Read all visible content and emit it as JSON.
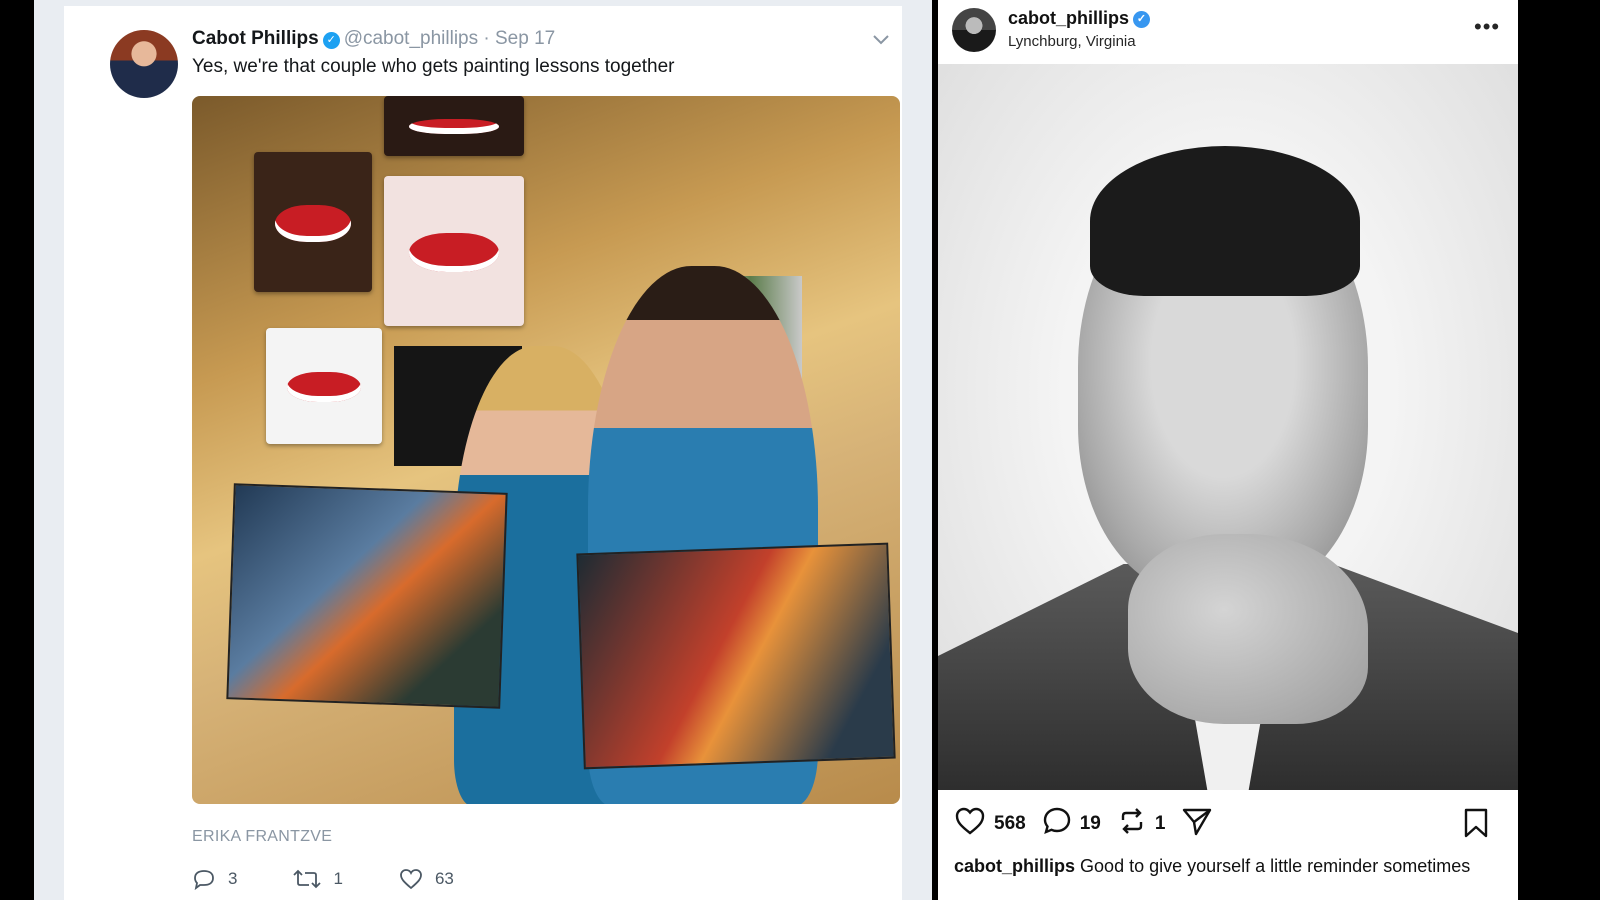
{
  "tweet": {
    "name": "Cabot Phillips",
    "verified_mark": "✓",
    "handle": "@cabot_phillips",
    "separator": "·",
    "date": "Sep 17",
    "text": "Yes, we're that couple who gets painting lessons together",
    "photo_credit": "ERIKA FRANTZVE",
    "actions": {
      "replies": "3",
      "retweets": "1",
      "likes": "63"
    },
    "icons": [
      "chevron-down-icon",
      "reply-icon",
      "retweet-icon",
      "heart-icon"
    ],
    "accent_color": "#1da1f2"
  },
  "instagram": {
    "username": "cabot_phillips",
    "verified_mark": "✓",
    "location": "Lynchburg, Virginia",
    "more": "•••",
    "actions": {
      "likes": "568",
      "comments": "19",
      "reposts": "1"
    },
    "caption_user": "cabot_phillips",
    "caption_text": "Good to give yourself a little reminder sometimes",
    "icons": [
      "heart-icon",
      "comment-icon",
      "repost-icon",
      "share-icon",
      "bookmark-icon"
    ],
    "accent_color": "#3897f0"
  }
}
